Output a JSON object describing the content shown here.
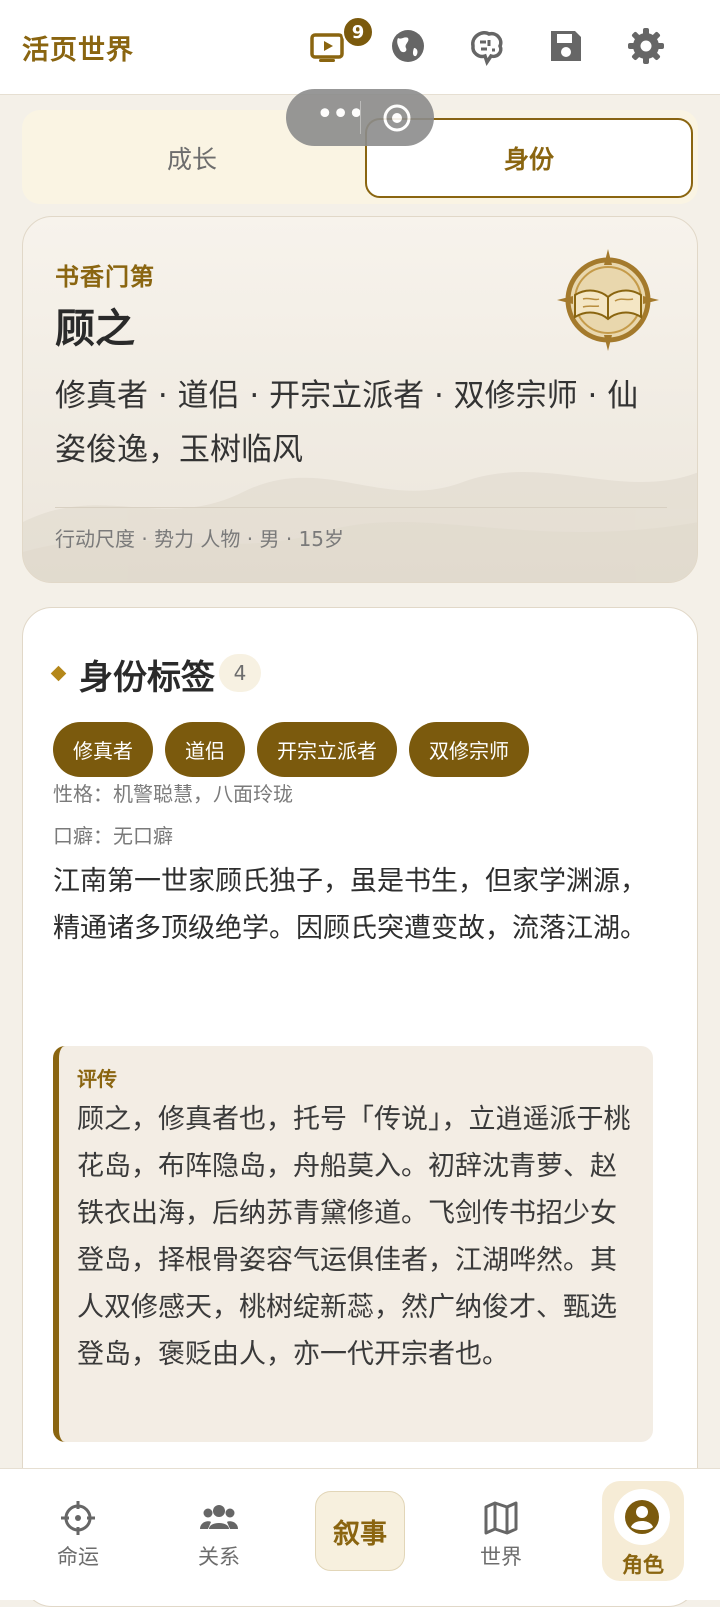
{
  "app": {
    "title": "活页世界"
  },
  "header": {
    "notification_count": "9"
  },
  "capsule": {
    "more": "•••"
  },
  "tabs": [
    {
      "label": "成长"
    },
    {
      "label": "身份"
    }
  ],
  "profile": {
    "family": "书香门第",
    "name": "顾之",
    "titles": "修真者 · 道侣 · 开宗立派者 · 双修宗师 · 仙姿俊逸，玉树临风",
    "meta": "行动尺度 · 势力  人物 · 男 · 15岁"
  },
  "identity_tags": {
    "title": "身份标签",
    "count": "4",
    "tags": [
      "修真者",
      "道侣",
      "开宗立派者",
      "双修宗师"
    ],
    "personality": "性格：机警聪慧，八面玲珑",
    "catchphrase": "口癖：无口癖",
    "description": "江南第一世家顾氏独子，虽是书生，但家学渊源，精通诸多顶级绝学。因顾氏突遭变故，流落江湖。",
    "review_label": "评传",
    "review_text": "顾之，修真者也，托号「传说」，立逍遥派于桃花岛，布阵隐岛，舟船莫入。初辞沈青萝、赵铁衣出海，后纳苏青黛修道。飞剑传书招少女登岛，择根骨姿容气运俱佳者，江湖哗然。其人双修感天，桃树绽新蕊，然广纳俊才、甄选登岛，褒贬由人，亦一代开宗者也。"
  },
  "bottom_nav": {
    "fate": "命运",
    "relations": "关系",
    "narrative": "叙事",
    "world": "世界",
    "character": "角色"
  },
  "colors": {
    "accent": "#8a6510",
    "chip": "#7b5a0d",
    "background": "#f4f0e8"
  }
}
